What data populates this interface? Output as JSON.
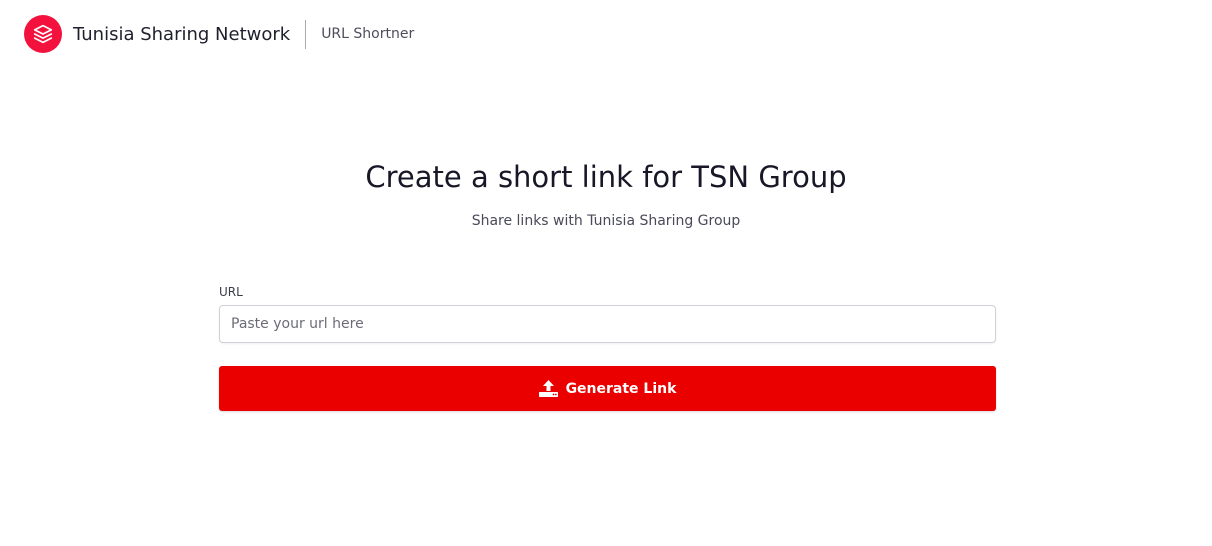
{
  "header": {
    "brand": "Tunisia Sharing Network",
    "app_name": "URL Shortner",
    "logo_icon": "layers-icon",
    "accent_color": "#f3123d"
  },
  "hero": {
    "title": "Create a short link for TSN Group",
    "subtitle": "Share links with Tunisia Sharing Group"
  },
  "form": {
    "url_label": "URL",
    "url_placeholder": "Paste your url here",
    "url_value": "",
    "submit_label": "Generate Link",
    "submit_icon": "upload-icon",
    "submit_color": "#eb0000"
  }
}
